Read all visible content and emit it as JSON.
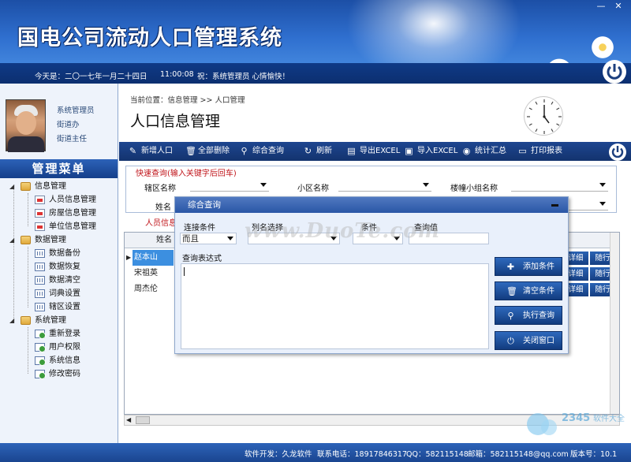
{
  "app": {
    "title": "国电公司流动人口管理系统",
    "date_label": "今天是：二〇一七年一月二十四日",
    "time": "11:00:08",
    "greeting": "祝：系统管理员 心情愉快！",
    "min_btn": "—",
    "close_btn": "✕"
  },
  "user": {
    "role": "系统管理员",
    "unit": "街道办",
    "title": "街道主任"
  },
  "menu": {
    "header": "管理菜单",
    "groups": [
      {
        "label": "信息管理",
        "items": [
          "人员信息管理",
          "房屋信息管理",
          "单位信息管理"
        ]
      },
      {
        "label": "数据管理",
        "items": [
          "数据备份",
          "数据恢复",
          "数据清空",
          "词典设置",
          "辖区设置"
        ]
      },
      {
        "label": "系统管理",
        "items": [
          "重新登录",
          "用户权限",
          "系统信息",
          "修改密码"
        ]
      }
    ]
  },
  "main": {
    "breadcrumb": "当前位置：信息管理 >> 人口管理",
    "page_title": "人口信息管理",
    "toolbar": [
      "新增人口",
      "全部删除",
      "综合查询",
      "刷新",
      "导出EXCEL",
      "导入EXCEL",
      "统计汇总",
      "打印报表"
    ],
    "quick_search": {
      "legend": "快速查询(输入关键字后回车)",
      "district_label": "辖区名称",
      "community_label": "小区名称",
      "building_label": "楼幢小组名称",
      "name_label": "姓名"
    },
    "list_title": "人员信息",
    "table": {
      "name_header": "姓名",
      "rows": [
        {
          "name": "赵本山",
          "detail": "详细",
          "action": "随行"
        },
        {
          "name": "宋祖英",
          "detail": "详细",
          "action": "随行"
        },
        {
          "name": "周杰伦",
          "detail": "详细",
          "action": "随行"
        }
      ]
    }
  },
  "dialog": {
    "title": "综合查询",
    "connect_label": "连接条件",
    "connect_value": "而且",
    "column_label": "列名选择",
    "condition_label": "条件",
    "query_value_label": "查询值",
    "expression_label": "查询表达式",
    "buttons": [
      "添加条件",
      "清空条件",
      "执行查询",
      "关闭窗口"
    ]
  },
  "watermark": "www.DuoTe.com",
  "footer": {
    "developer": "软件开发：久龙软件",
    "phone": "联系电话：18917846317",
    "qq": "QQ：582115148",
    "email": "邮箱：582115148@qq.com",
    "version": "版本号：10.1"
  },
  "colors": {
    "header_blue": "#2f6fcf",
    "toolbar_navy": "#1e4690",
    "selected_row": "#3c8fe0",
    "legend_red": "#c0141a"
  }
}
